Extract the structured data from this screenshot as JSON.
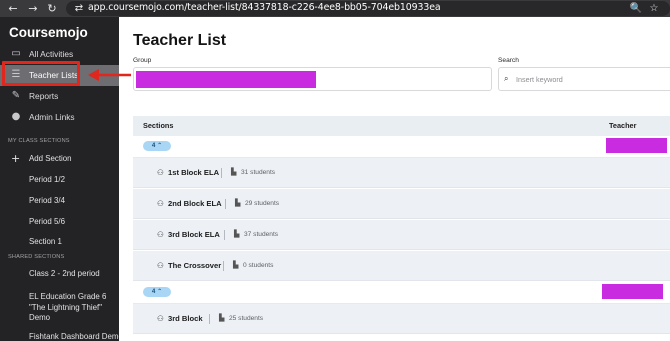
{
  "browser": {
    "back_icon": "←",
    "forward_icon": "→",
    "reload_icon": "↻",
    "url_icon": "⇄",
    "url": "app.coursemojo.com/teacher-list/84337818-c226-4ee8-bb05-704eb10933ea",
    "zoom_icon": "🔍",
    "star_icon": "☆"
  },
  "sidebar": {
    "brand": "Coursemojo",
    "items": [
      {
        "label": "All Activities",
        "icon": "folder-icon",
        "glyph": "▭"
      },
      {
        "label": "Teacher Lists",
        "icon": "list-icon",
        "glyph": "☰"
      },
      {
        "label": "Reports",
        "icon": "edit-icon",
        "glyph": "✎"
      },
      {
        "label": "Admin Links",
        "icon": "link-icon",
        "glyph": "●"
      }
    ],
    "my_class_sections_heading": "MY CLASS SECTIONS",
    "add_section_label": "Add Section",
    "add_icon": "+",
    "my_sections": [
      "Period 1/2",
      "Period 3/4",
      "Period 5/6",
      "Section 1"
    ],
    "shared_sections_heading": "SHARED SECTIONS",
    "shared_sections": [
      "Class 2 - 2nd period",
      "EL Education Grade 6 \"The Lightning Thief\" Demo",
      "Fishtank Dashboard Demo"
    ]
  },
  "annotation": {
    "highlight_color": "#e0261d"
  },
  "main": {
    "title": "Teacher List",
    "group_label": "Group",
    "search_label": "Search",
    "search_placeholder": "Insert keyword",
    "search_icon": "⌕",
    "redaction_color": "#c92ce0",
    "table": {
      "col_sections": "Sections",
      "col_teacher": "Teacher",
      "groups": [
        {
          "badge": "4",
          "chevron": "⌃",
          "sections": [
            {
              "name": "1st Block ELA",
              "students": "31 students"
            },
            {
              "name": "2nd Block ELA",
              "students": "29 students"
            },
            {
              "name": "3rd Block ELA",
              "students": "37 students"
            },
            {
              "name": "The Crossover",
              "students": "0 students"
            }
          ]
        },
        {
          "badge": "4",
          "chevron": "⌃",
          "sections": [
            {
              "name": "3rd Block",
              "students": "25 students"
            }
          ]
        }
      ]
    },
    "section_icon": "⚇",
    "student_icon": "▙"
  }
}
